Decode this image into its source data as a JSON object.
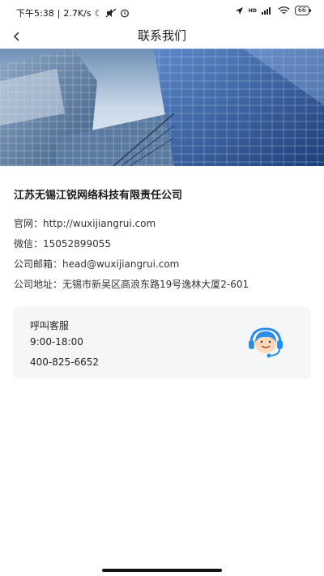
{
  "status_bar": {
    "time": "下午5:38",
    "network_speed": "2.7K/s",
    "network_type": "HD",
    "battery": "66"
  },
  "nav": {
    "title": "联系我们"
  },
  "company": {
    "name": "江苏无锡江锐网络科技有限责任公司",
    "website": "官网：http://wuxijiangrui.com",
    "wechat": "微信：15052899055",
    "email": "公司邮箱：head@wuxijiangrui.com",
    "address": "公司地址：无锡市新吴区高浪东路19号逸林大厦2-601"
  },
  "service": {
    "title": "呼叫客服",
    "hours": "9:00-18:00",
    "phone": "400-825-6652"
  },
  "icons": [
    "back-icon",
    "customer-service-icon",
    "signal-icon",
    "wifi-icon",
    "battery-icon",
    "alarm-icon",
    "moon-icon"
  ],
  "colors": {
    "accent": "#2b8ee8",
    "card_bg": "#f5f6f7"
  }
}
